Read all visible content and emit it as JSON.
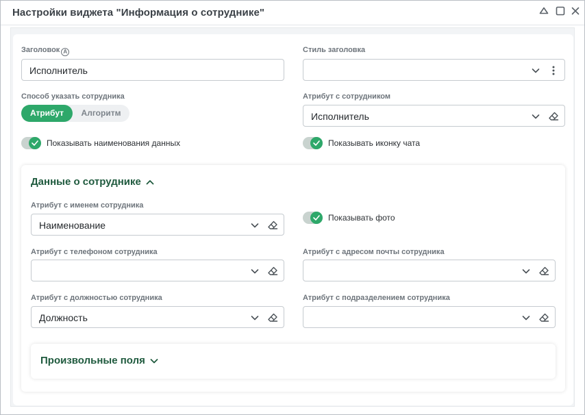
{
  "window": {
    "title": "Настройки виджета \"Информация о сотруднике\""
  },
  "form": {
    "header_label": "Заголовок",
    "header_help_glyph": "A",
    "header_value": "Исполнитель",
    "header_style_label": "Стиль заголовка",
    "header_style_value": "",
    "employee_mode_label": "Способ указать сотрудника",
    "mode_options": [
      "Атрибут",
      "Алгоритм"
    ],
    "mode_selected": "Атрибут",
    "employee_attr_label": "Атрибут с сотрудником",
    "employee_attr_value": "Исполнитель",
    "show_data_names_label": "Показывать наименования данных",
    "show_data_names_on": true,
    "show_chat_icon_label": "Показывать иконку чата",
    "show_chat_icon_on": true
  },
  "employee_data": {
    "title": "Данные о сотруднике",
    "expanded": true,
    "name_attr_label": "Атрибут с именем сотрудника",
    "name_attr_value": "Наименование",
    "show_photo_label": "Показывать фото",
    "show_photo_on": true,
    "phone_attr_label": "Атрибут с телефоном сотрудника",
    "phone_attr_value": "",
    "email_attr_label": "Атрибут с адресом почты сотрудника",
    "email_attr_value": "",
    "position_attr_label": "Атрибут с должностью сотрудника",
    "position_attr_value": "Должность",
    "department_attr_label": "Атрибут с подразделением сотрудника",
    "department_attr_value": ""
  },
  "custom_fields": {
    "title": "Произвольные поля",
    "expanded": false
  },
  "colors": {
    "accent": "#2ea86a",
    "section_title": "#1f5a3e",
    "label": "#6d747b"
  },
  "icons": {
    "collapse": "caret-up-icon",
    "maximize": "square-icon",
    "close": "close-icon",
    "dropdown": "chevron-down-icon",
    "clear": "eraser-icon",
    "more": "kebab-icon",
    "toggle_check": "check-icon"
  }
}
